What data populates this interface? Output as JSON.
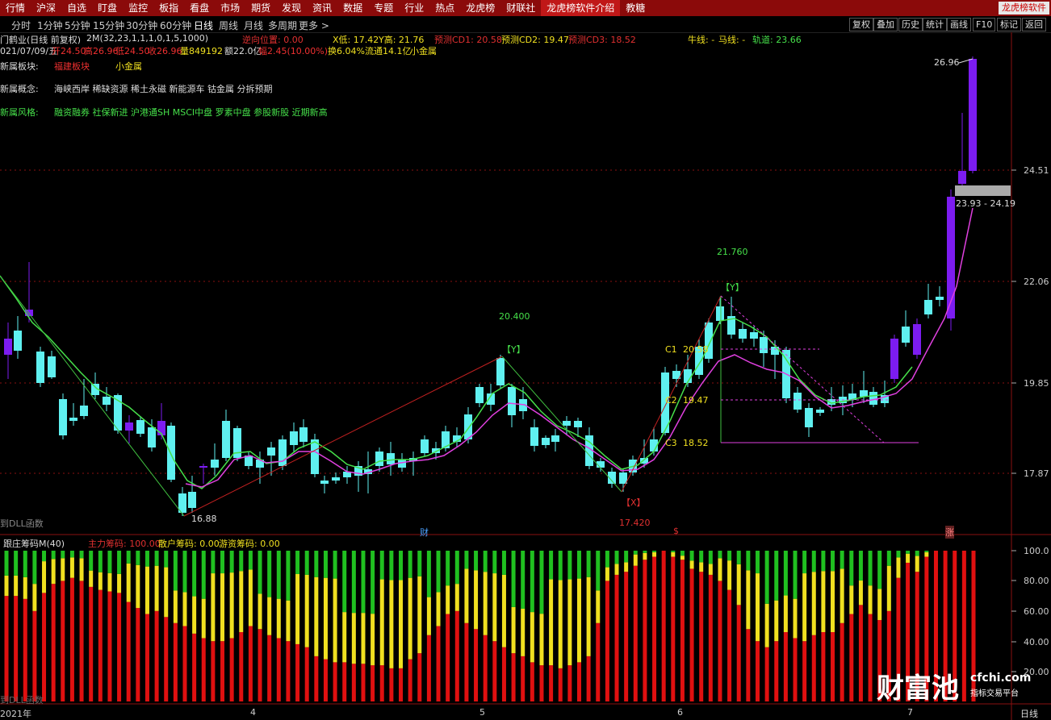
{
  "menu": [
    "行情",
    "沪深",
    "自选",
    "盯盘",
    "监控",
    "板指",
    "看盘",
    "市场",
    "期货",
    "发现",
    "资讯",
    "数据",
    "专题",
    "行业",
    "热点",
    "龙虎榜",
    "财联社",
    "龙虎榜软件介绍",
    "教糖"
  ],
  "menu_active_index": 17,
  "brand": "龙虎榜软件",
  "periods": [
    "分时",
    "1分钟",
    "5分钟",
    "15分钟",
    "30分钟",
    "60分钟",
    "日线",
    "周线",
    "月线",
    "多周期",
    "更多 >"
  ],
  "active_period": "日线",
  "right_buttons": [
    "复权",
    "叠加",
    "历史",
    "统计",
    "画线",
    "F10",
    "标记",
    "返回"
  ],
  "header": {
    "stock": "门鹤业(日线 前复权)",
    "indicator": "2M(32,23,1,1,1,0,1,5,1000)",
    "reverse_label": "逆向位置: 0.00",
    "x_low": "X低: 17.42",
    "y_high": "Y高: 21.76",
    "cd1": "预测CD1: 20.58",
    "cd2": "预测CD2: 19.47",
    "cd3": "预测CD3: 18.52",
    "bull": "牛线: -",
    "horse": "马线: -",
    "track": "轨道: 23.66"
  },
  "quote": {
    "date": "021/07/09/五",
    "open": "开24.50",
    "high": "高26.96",
    "low": "低24.50",
    "close": "收26.96",
    "volume": "量849192",
    "amount": "额22.0亿",
    "change": "幅2.45(10.00%)",
    "turnover": "换6.04%",
    "float": "流通14.1亿",
    "sector": "小金属"
  },
  "info_rows": {
    "plate_label": "新属板块:",
    "plate_value": "福建板块",
    "plate_value2": "小金属",
    "concept_label": "新属概念:",
    "concept_value": "海峡西岸 稀缺资源 稀土永磁 新能源车 钴金属 分拆预期",
    "style_label": "新属风格:",
    "style_value": "融资融券 社保新进 沪港通SH MSCI中盘 罗素中盘 参股新股 近期新高"
  },
  "chart_labels": {
    "price_26": "26.96",
    "range_box": "23.93 - 24.19",
    "low_16": "16.88",
    "p20_400": "20.400",
    "p21_760": "21.760",
    "p17_420": "17.420",
    "y1": "【Y】",
    "y2": "【Y】",
    "x1": "【X】",
    "c1": "C1",
    "c1v": "20.58",
    "c2": "C2",
    "c2v": "19.47",
    "c3": "C3",
    "c3v": "18.52",
    "dll1": "到DLL函数",
    "dll2": "到DLL函数",
    "fin1": "财",
    "fin2": "$",
    "rise": "涨"
  },
  "price_axis": [
    "24.51",
    "22.06",
    "19.85",
    "17.87"
  ],
  "lower_header": {
    "name": "跟庄筹码M(40)",
    "main": "主力筹码: 100.00",
    "retail": "散户筹码: 0.00",
    "hot": "游资筹码: 0.00"
  },
  "lower_axis": [
    "100.0",
    "80.00",
    "60.00",
    "40.00",
    "20.00"
  ],
  "time_axis": [
    "2021年",
    "4",
    "5",
    "6",
    "7"
  ],
  "bottom_right": "日线",
  "watermark": {
    "brand": "财富池",
    "url": "cfchi.com",
    "slogan": "指标交易平台"
  },
  "colors": {
    "up": "#7c1cf0",
    "down": "#5ff0f0",
    "ma_green": "#46e04a",
    "ma_magenta": "#e040e0",
    "grid_red": "#8a1010",
    "main": "#e01010",
    "retail": "#f0e020",
    "hot": "#20c020"
  }
}
